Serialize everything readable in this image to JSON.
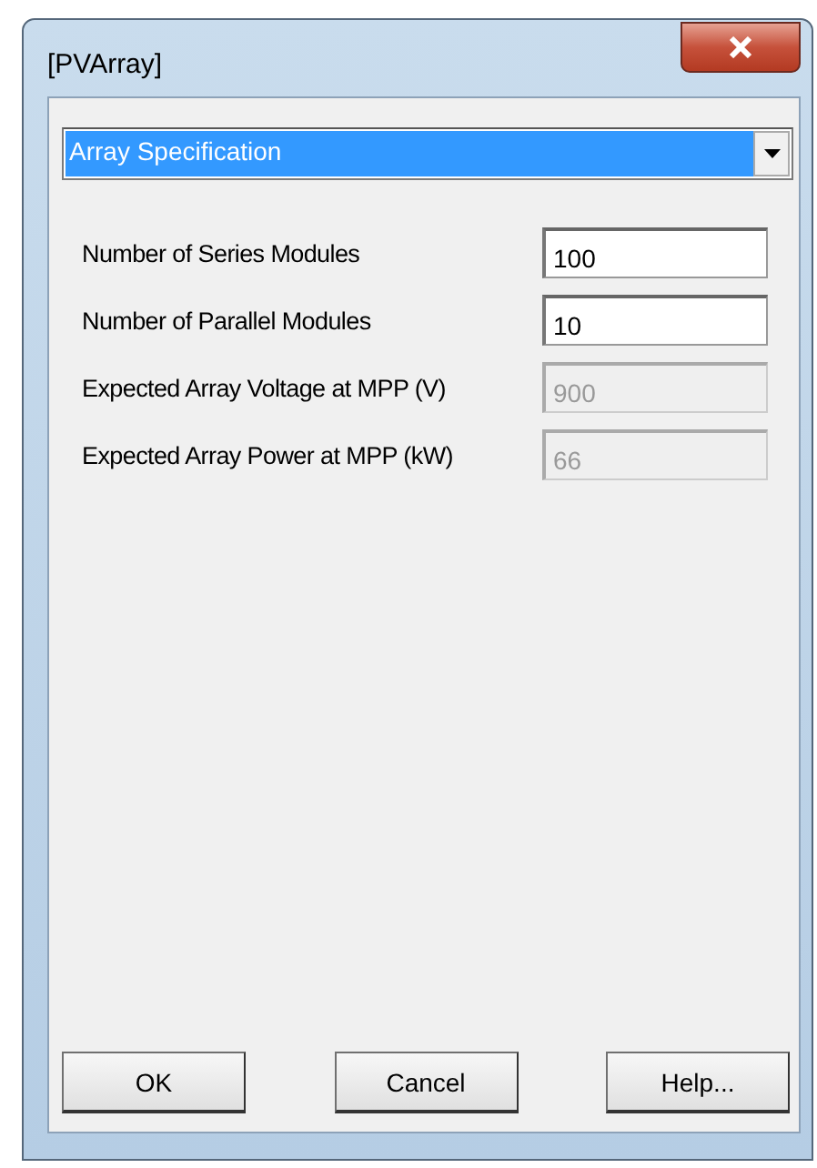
{
  "window": {
    "title": "[PVArray]"
  },
  "section_select": {
    "value": "Array Specification"
  },
  "fields": [
    {
      "label": "Number of Series Modules",
      "value": "100",
      "disabled": false
    },
    {
      "label": "Number of Parallel Modules",
      "value": "10",
      "disabled": false
    },
    {
      "label": "Expected Array Voltage at MPP (V)",
      "value": "900",
      "disabled": true
    },
    {
      "label": "Expected Array Power at MPP (kW)",
      "value": "66",
      "disabled": true
    }
  ],
  "buttons": [
    "OK",
    "Cancel",
    "Help..."
  ]
}
